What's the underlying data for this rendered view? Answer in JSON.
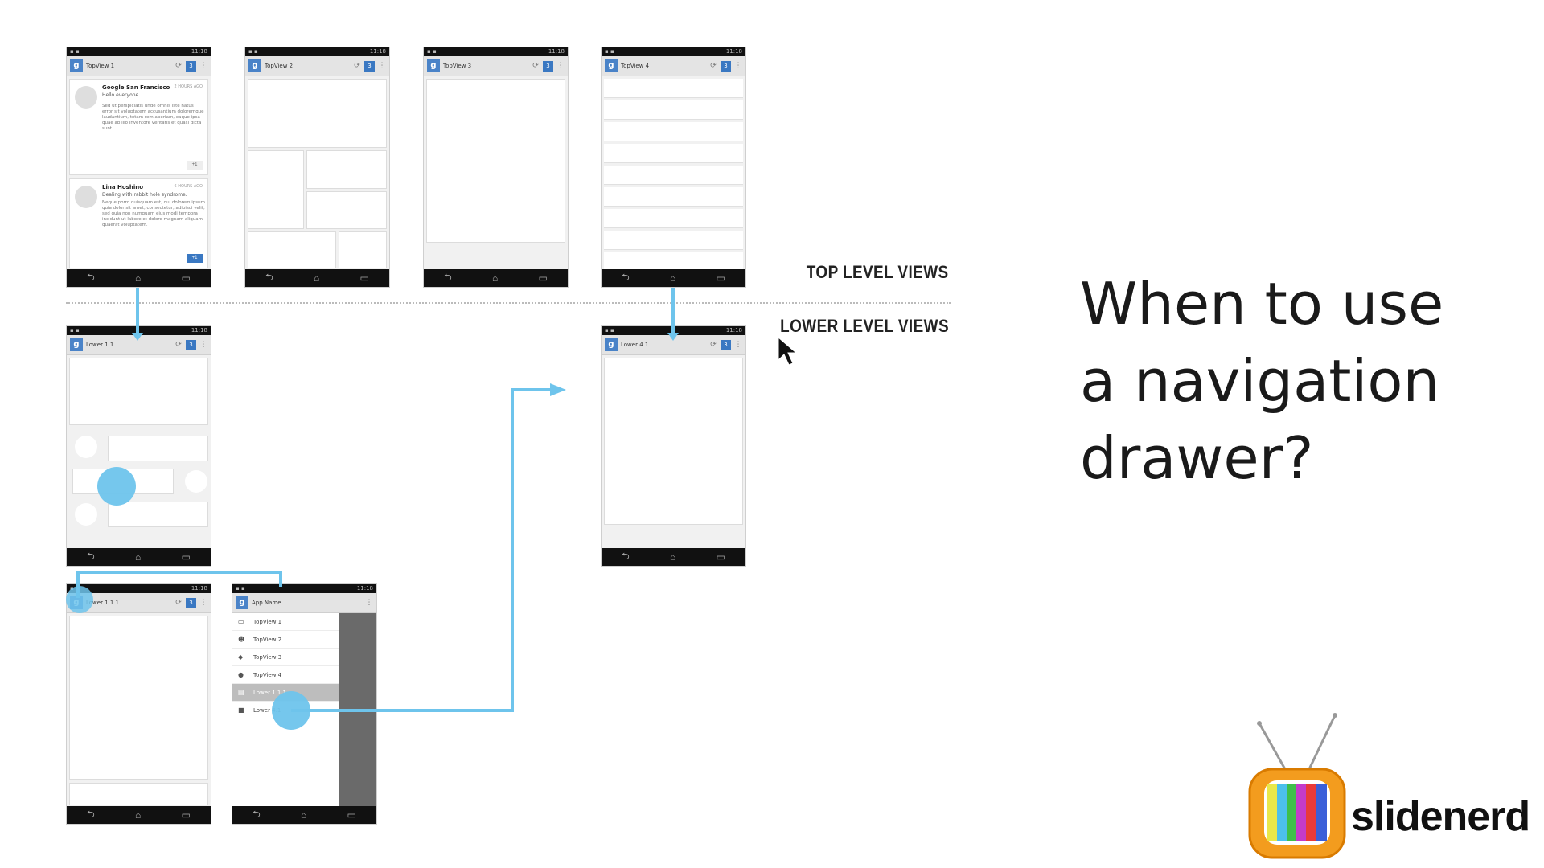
{
  "status_time": "11:18",
  "top_views": [
    {
      "title": "TopView 1"
    },
    {
      "title": "TopView 2"
    },
    {
      "title": "TopView 3"
    },
    {
      "title": "TopView 4"
    }
  ],
  "posts": [
    {
      "name": "Google San Francisco",
      "time": "2 HOURS AGO",
      "subtitle": "Hello everyone.",
      "body": "Sed ut perspiciatis unde omnis iste natus error sit voluptatem accusantium doloremque laudantium, totam rem aperiam, eaque ipsa quae ab illo inventore veritatis et quasi dicta sunt.",
      "plus": "+1"
    },
    {
      "name": "Lina Hoshino",
      "time": "6 HOURS AGO",
      "subtitle": "Dealing with rabbit hole syndrome.",
      "body": "Neque porro quisquam est, qui dolorem ipsum quia dolor sit amet, consectetur, adipisci velit, sed quia non numquam eius modi tempora incidunt ut labore et dolore magnam aliquam quaerat voluptatem.",
      "plus": "+1"
    }
  ],
  "lower_views": {
    "lower_1_1": "Lower 1.1",
    "lower_4_1": "Lower 4.1",
    "lower_1_1_1": "Lower 1.1.1"
  },
  "drawer": {
    "app_name": "App Name",
    "items": [
      {
        "label": "TopView 1",
        "icon": "inbox-icon"
      },
      {
        "label": "TopView 2",
        "icon": "people-icon"
      },
      {
        "label": "TopView 3",
        "icon": "tag-icon"
      },
      {
        "label": "TopView 4",
        "icon": "circle-icon"
      },
      {
        "label": "Lower 1.1.1",
        "icon": "chat-icon",
        "selected": true
      },
      {
        "label": "Lower 4.1",
        "icon": "folder-icon"
      }
    ]
  },
  "labels": {
    "top_level": "TOP LEVEL VIEWS",
    "lower_level": "LOWER LEVEL VIEWS"
  },
  "heading": {
    "line1": "When to use",
    "line2": "a navigation",
    "line3": "drawer?"
  },
  "brand": {
    "name": "slidenerd"
  },
  "colors": {
    "arrow": "#6ec4ec",
    "touch": "#6ec4ec",
    "action_blue": "#3a78c2",
    "bar_dark": "#111111"
  }
}
